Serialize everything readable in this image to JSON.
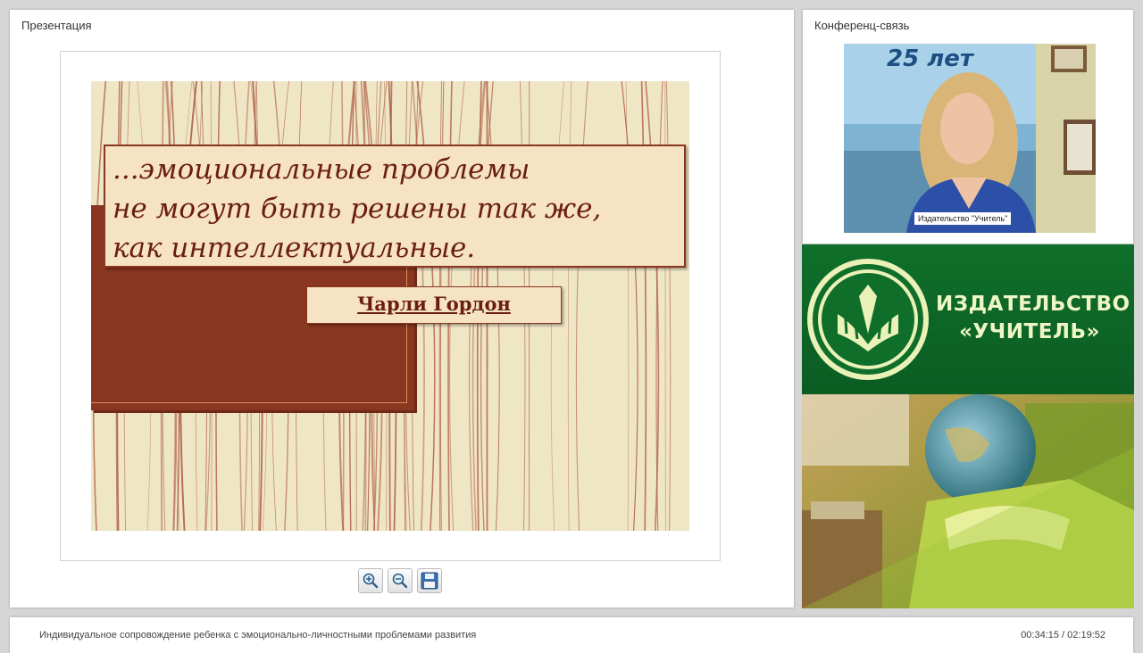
{
  "presentation": {
    "title": "Презентация",
    "slide": {
      "quote_lines": [
        "...эмоциональные проблемы",
        "не могут быть решены так же,",
        "как интеллектуальные."
      ],
      "author": "Чарли Гордон",
      "colors": {
        "background": "#efe6c6",
        "accent": "#8a3620",
        "text": "#6a1e12"
      }
    },
    "toolbar": {
      "buttons": [
        "zoom-in-icon",
        "zoom-out-icon",
        "save-icon"
      ]
    }
  },
  "conference": {
    "title": "Конференц-связь",
    "video_caption": "Издательство \"Учитель\"",
    "poster_text": "25 лет"
  },
  "banner": {
    "title_line1": "ИЗДАТЕЛЬСТВО",
    "title_line2": "«УЧИТЕЛЬ»",
    "colors": {
      "background": "#0f6f2a",
      "text": "#eef6c6"
    }
  },
  "footer": {
    "title": "Индивидуальное сопровождение ребенка с эмоционально-личностными проблемами развития",
    "time": "00:34:15 / 02:19:52"
  }
}
